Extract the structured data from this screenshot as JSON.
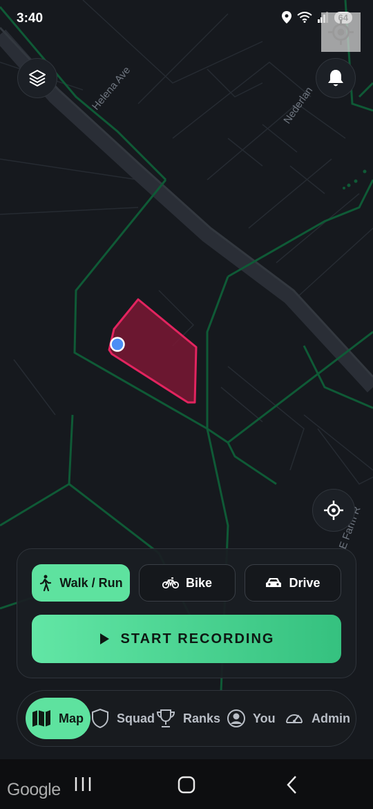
{
  "status_bar": {
    "time": "3:40",
    "battery": "64"
  },
  "map": {
    "street_labels": [
      "Helena Ave",
      "Nederlan",
      "E Farm R"
    ],
    "attribution": "Google",
    "colors": {
      "background": "#16191e",
      "road": "#0f5a36",
      "highway": "#2a2e36",
      "zone_fill": "#7a1734",
      "zone_stroke": "#e2245f",
      "user_dot": "#4a8ef5"
    }
  },
  "top_controls": {
    "layers": "layers-icon",
    "notifications": "bell-icon"
  },
  "recenter": "crosshair-icon",
  "modes": [
    {
      "label": "Walk / Run",
      "icon": "walk-icon",
      "active": true
    },
    {
      "label": "Bike",
      "icon": "bike-icon",
      "active": false
    },
    {
      "label": "Drive",
      "icon": "car-icon",
      "active": false
    }
  ],
  "record": {
    "label": "START RECORDING",
    "icon": "play-icon"
  },
  "nav": [
    {
      "label": "Map",
      "icon": "map-icon",
      "active": true
    },
    {
      "label": "Squad",
      "icon": "shield-icon",
      "active": false
    },
    {
      "label": "Ranks",
      "icon": "trophy-icon",
      "active": false
    },
    {
      "label": "You",
      "icon": "user-icon",
      "active": false
    },
    {
      "label": "Admin",
      "icon": "speedometer-icon",
      "active": false
    }
  ],
  "accent_color": "#5ee29f"
}
